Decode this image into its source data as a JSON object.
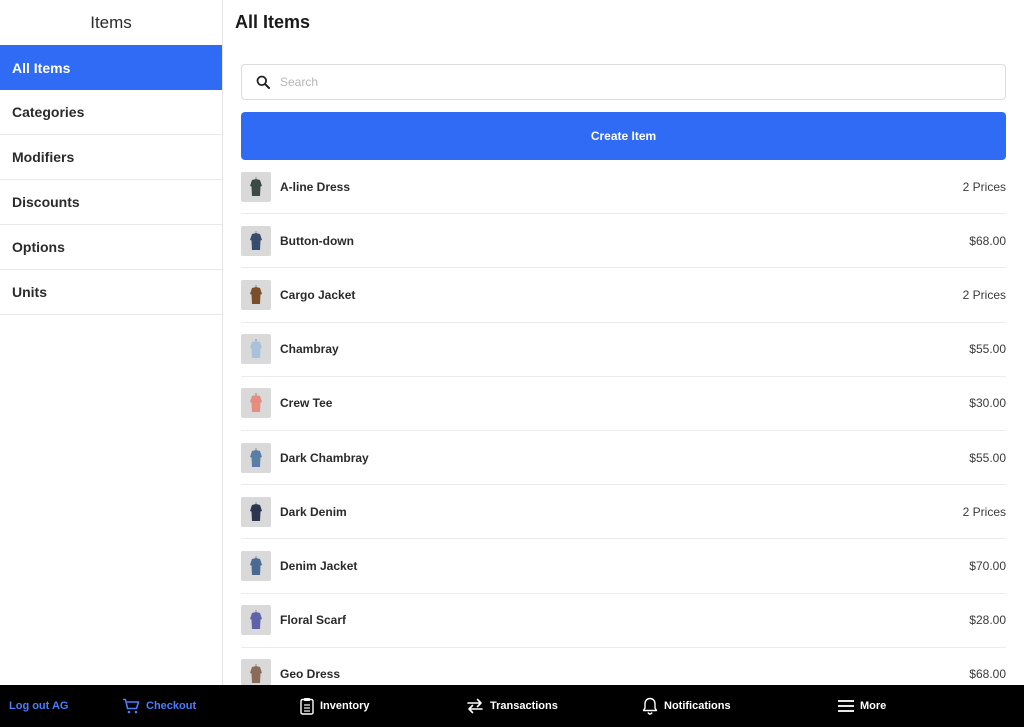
{
  "sidebar": {
    "title": "Items",
    "items": [
      {
        "label": "All Items",
        "active": true
      },
      {
        "label": "Categories"
      },
      {
        "label": "Modifiers"
      },
      {
        "label": "Discounts"
      },
      {
        "label": "Options"
      },
      {
        "label": "Units"
      }
    ]
  },
  "main": {
    "title": "All Items",
    "search_placeholder": "Search",
    "create_button": "Create Item",
    "items": [
      {
        "name": "A-line Dress",
        "price": "2 Prices",
        "color": "#3c4a45"
      },
      {
        "name": "Button-down",
        "price": "$68.00",
        "color": "#3a4c6e"
      },
      {
        "name": "Cargo Jacket",
        "price": "2 Prices",
        "color": "#7a4e28"
      },
      {
        "name": "Chambray",
        "price": "$55.00",
        "color": "#a9c2dc"
      },
      {
        "name": "Crew Tee",
        "price": "$30.00",
        "color": "#e58d80"
      },
      {
        "name": "Dark Chambray",
        "price": "$55.00",
        "color": "#5a7fa6"
      },
      {
        "name": "Dark Denim",
        "price": "2 Prices",
        "color": "#2c3650"
      },
      {
        "name": "Denim Jacket",
        "price": "$70.00",
        "color": "#4a6a94"
      },
      {
        "name": "Floral Scarf",
        "price": "$28.00",
        "color": "#5d63a8"
      },
      {
        "name": "Geo Dress",
        "price": "$68.00",
        "color": "#8a6a58"
      }
    ]
  },
  "bottombar": {
    "logout": "Log out AG",
    "checkout": "Checkout",
    "inventory": "Inventory",
    "transactions": "Transactions",
    "notifications": "Notifications",
    "more": "More"
  },
  "colors": {
    "accent": "#2f6bf5",
    "bottombar_bg": "#000000",
    "bottombar_active": "#4a7dff"
  }
}
